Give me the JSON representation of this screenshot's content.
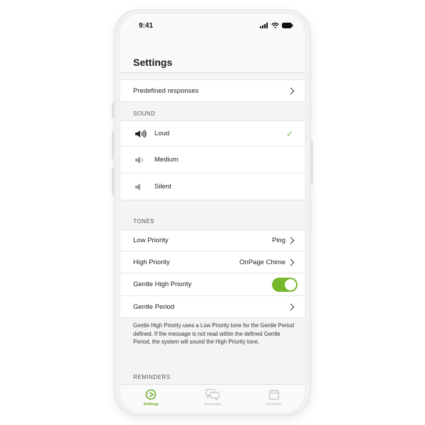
{
  "status_bar": {
    "time": "9:41"
  },
  "header": {
    "title": "Settings"
  },
  "rows": {
    "predefined_responses": "Predefined responses"
  },
  "sound": {
    "section_title": "SOUND",
    "options": [
      {
        "label": "Loud",
        "icon": "speaker-loud-icon",
        "selected": true
      },
      {
        "label": "Medium",
        "icon": "speaker-medium-icon",
        "selected": false
      },
      {
        "label": "Silent",
        "icon": "speaker-silent-icon",
        "selected": false
      }
    ]
  },
  "tones": {
    "section_title": "TONES",
    "low_priority": {
      "label": "Low Priority",
      "value": "Ping"
    },
    "high_priority": {
      "label": "High Priority",
      "value": "OnPage Chime"
    },
    "gentle_high_priority": {
      "label": "Gentle High Priority",
      "enabled": true
    },
    "gentle_period": {
      "label": "Gentle Period"
    },
    "note": "Gentle High Priority uses a Low Priority tone for the Gentle Period defined. If the message is not read within the defined Gentle Period, the system will sound the High Priority tone."
  },
  "reminders": {
    "section_title": "REMINDERS"
  },
  "tabbar": {
    "tabs": [
      {
        "label": "Settings",
        "icon": "settings-play-icon",
        "active": true
      },
      {
        "label": "Messages",
        "icon": "messages-icon",
        "active": false
      },
      {
        "label": "Schedule",
        "icon": "schedule-icon",
        "active": false
      }
    ]
  },
  "colors": {
    "accent": "#76b82a",
    "check": "#7bbd3a"
  }
}
